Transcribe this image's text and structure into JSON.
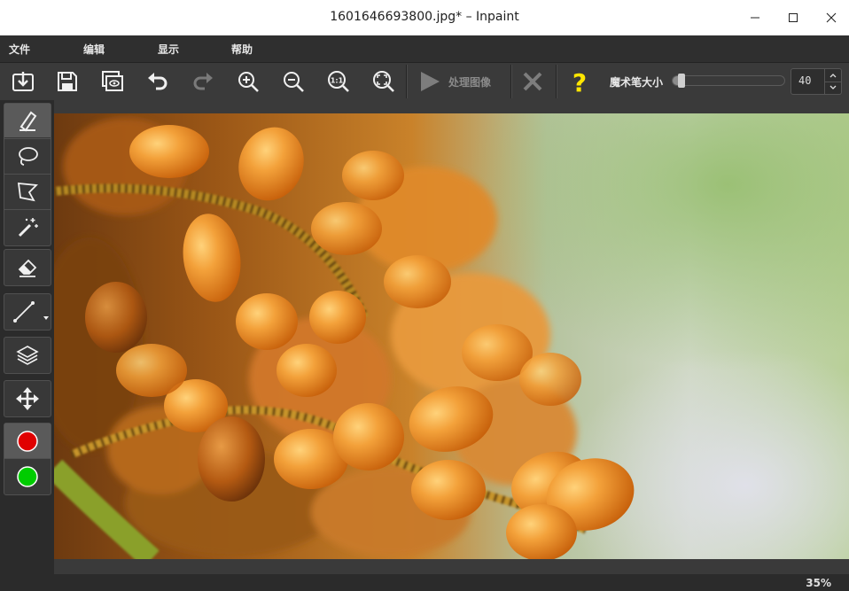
{
  "window": {
    "title": "1601646693800.jpg* – Inpaint",
    "controls": [
      "minimize-icon",
      "maximize-icon",
      "close-icon"
    ]
  },
  "menu": {
    "items": [
      {
        "label": "文件"
      },
      {
        "label": "编辑"
      },
      {
        "label": "显示"
      },
      {
        "label": "帮助"
      }
    ]
  },
  "toolbar": {
    "buttons": [
      {
        "icon": "open-icon"
      },
      {
        "icon": "save-icon"
      },
      {
        "icon": "preview-icon"
      },
      {
        "icon": "undo-icon"
      },
      {
        "icon": "redo-icon"
      },
      {
        "icon": "zoom-in-icon"
      },
      {
        "icon": "zoom-out-icon"
      },
      {
        "icon": "actual-size-icon"
      },
      {
        "icon": "fit-to-window-icon"
      }
    ],
    "process_label": "处理图像",
    "cancel_icon": "cancel-icon",
    "help_icon": "help-icon",
    "brush_size_label": "魔术笔大小",
    "brush_size_value": "40",
    "brush_size_fraction": 0.05,
    "help_color": "#ffe600"
  },
  "tools": [
    {
      "icon": "marker-icon",
      "active": true
    },
    {
      "icon": "lasso-icon"
    },
    {
      "icon": "polygon-lasso-icon"
    },
    {
      "icon": "magic-wand-icon"
    },
    {
      "icon": "eraser-icon"
    },
    {
      "icon": "line-icon"
    },
    {
      "icon": "layers-icon"
    },
    {
      "icon": "move-icon"
    },
    {
      "icon": "red-marker-icon",
      "color": "#e00000"
    },
    {
      "icon": "green-marker-icon",
      "color": "#00cc00"
    }
  ],
  "status": {
    "zoom": "35%"
  }
}
